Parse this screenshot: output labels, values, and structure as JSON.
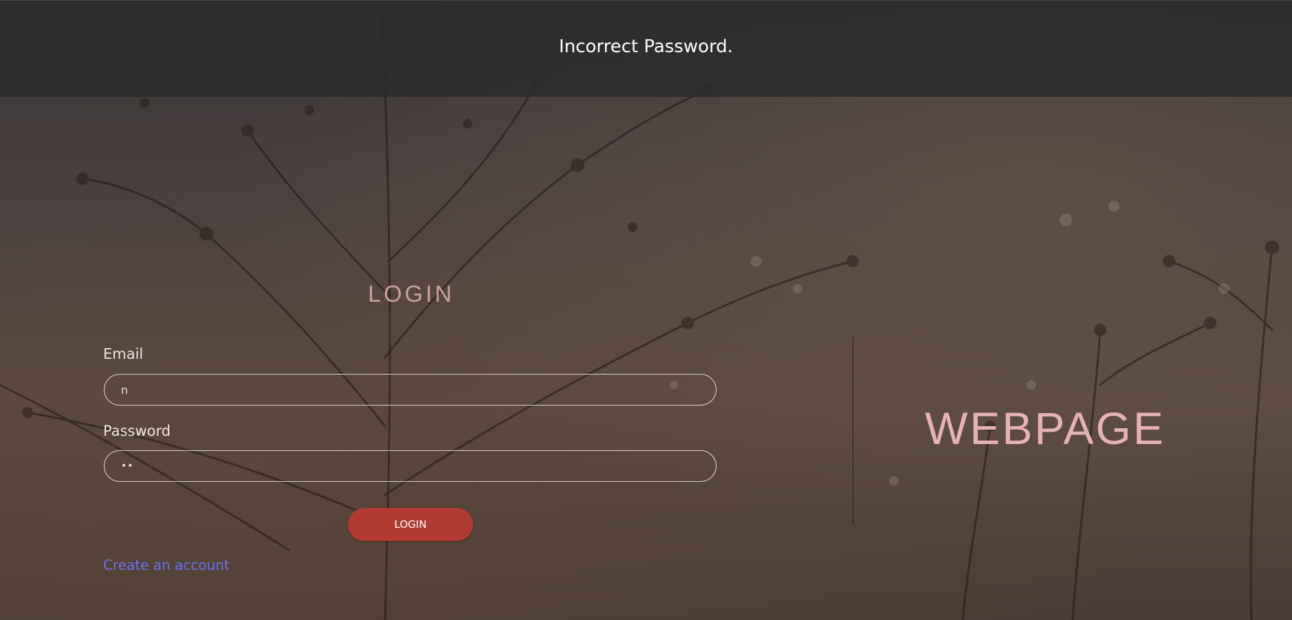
{
  "alert": {
    "message": "Incorrect Password."
  },
  "login_form": {
    "title": "LOGIN",
    "email": {
      "label": "Email",
      "value": "n"
    },
    "password": {
      "label": "Password",
      "value": "••"
    },
    "submit_label": "LOGIN",
    "create_account_label": "Create an account"
  },
  "brand": {
    "name": "WEBPAGE"
  },
  "colors": {
    "alert_bar": "#2c2b2e",
    "accent_button": "#b33a33",
    "link": "#6b73e6",
    "brand_text": "#e5b3b3",
    "title_text": "#c9a0a0"
  },
  "icons": {
    "background": "dried-flower-branches-photo"
  }
}
